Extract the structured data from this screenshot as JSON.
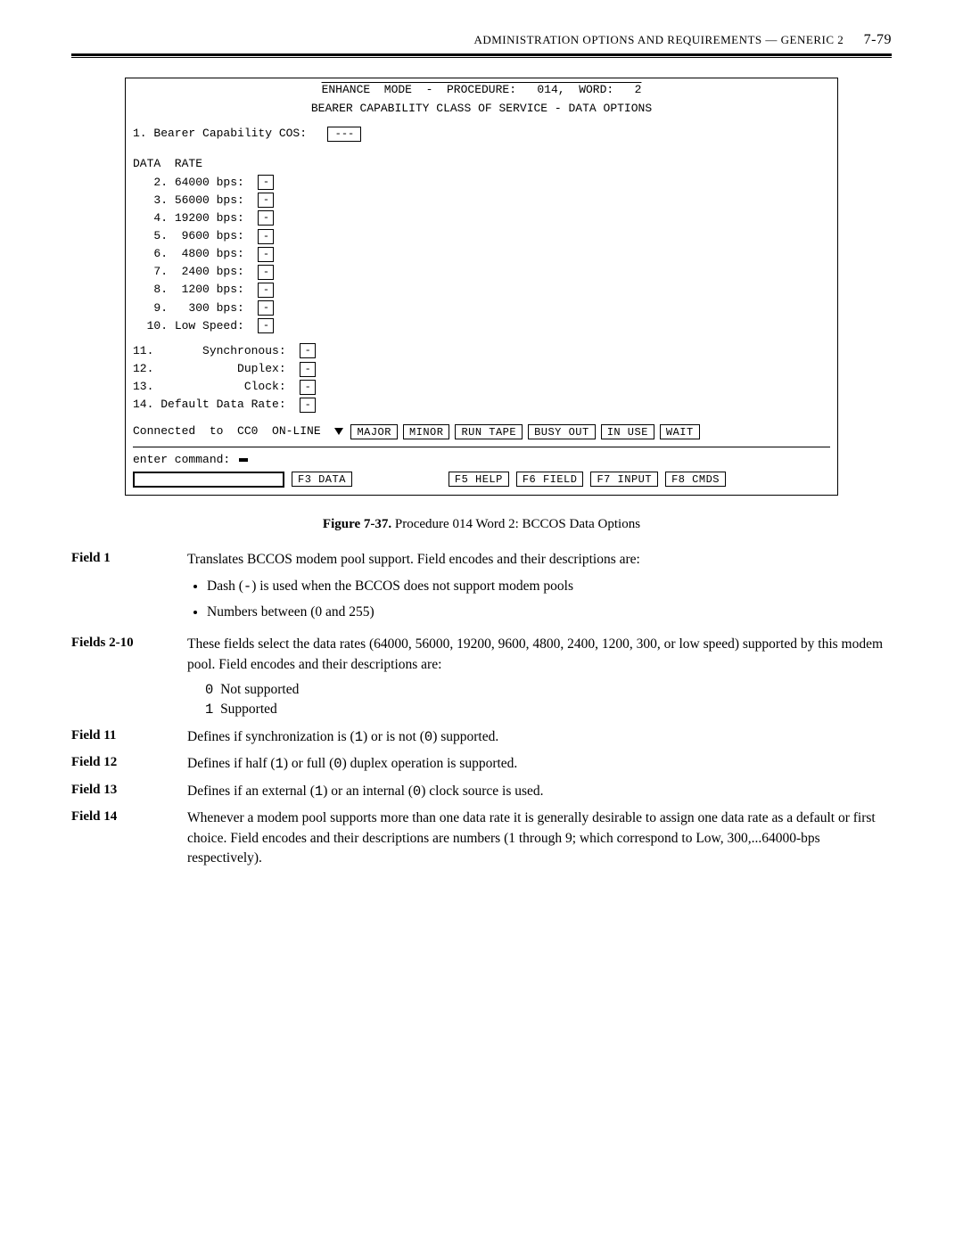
{
  "header": {
    "running_title": "ADMINISTRATION  OPTIONS  AND  REQUIREMENTS  —  GENERIC  2",
    "page_number": "7-79"
  },
  "terminal": {
    "mode_line": "ENHANCE  MODE  -  PROCEDURE:   014,  WORD:   2",
    "subtitle": "BEARER  CAPABILITY  CLASS  OF  SERVICE  -  DATA  OPTIONS",
    "field1_label": "1. Bearer Capability COS:",
    "field1_value": "---",
    "data_rate_heading": "DATA  RATE",
    "rates": [
      {
        "idx": " 2.",
        "label": "64000 bps:",
        "val": "-"
      },
      {
        "idx": " 3.",
        "label": "56000 bps:",
        "val": "-"
      },
      {
        "idx": " 4.",
        "label": "19200 bps:",
        "val": "-"
      },
      {
        "idx": " 5.",
        "label": " 9600 bps:",
        "val": "-"
      },
      {
        "idx": " 6.",
        "label": " 4800 bps:",
        "val": "-"
      },
      {
        "idx": " 7.",
        "label": " 2400 bps:",
        "val": "-"
      },
      {
        "idx": " 8.",
        "label": " 1200 bps:",
        "val": "-"
      },
      {
        "idx": " 9.",
        "label": "  300 bps:",
        "val": "-"
      },
      {
        "idx": "10.",
        "label": "Low Speed:",
        "val": "-"
      }
    ],
    "extras": [
      {
        "idx": "11.",
        "label": "      Synchronous:",
        "val": "-"
      },
      {
        "idx": "12.",
        "label": "           Duplex:",
        "val": "-"
      },
      {
        "idx": "13.",
        "label": "            Clock:",
        "val": "-"
      },
      {
        "idx": "14.",
        "label": "Default Data Rate:",
        "val": "-"
      }
    ],
    "status_prefix": "Connected  to  CC0  ON-LINE ",
    "status_buttons": [
      "MAJOR",
      "MINOR",
      "RUN TAPE",
      "BUSY OUT",
      "IN USE",
      "WAIT"
    ],
    "cmd_label": "enter  command:",
    "fkeys_row1": [
      "F3 DATA"
    ],
    "fkeys_row2": [
      "F5 HELP",
      "F6 FIELD",
      "F7 INPUT",
      "F8 CMDS"
    ]
  },
  "figure": {
    "label": "Figure 7-37.",
    "caption": "Procedure 014 Word 2: BCCOS Data Options"
  },
  "definitions": {
    "field1": {
      "label": "Field 1",
      "text": "Translates BCCOS modem pool support. Field encodes and their descriptions are:",
      "bullet1a": "Dash (",
      "bullet1_dash": "-",
      "bullet1b": ")  is used when the BCCOS does not support modem pools",
      "bullet2": "Numbers between (0 and 255)"
    },
    "fields2_10": {
      "label": "Fields 2-10",
      "text": "These fields select the data rates (64000, 56000, 19200, 9600, 4800, 2400, 1200, 300, or low speed) supported by this modem pool. Field encodes and their descriptions are:",
      "code0": "0",
      "opt0": "Not supported",
      "code1": "1",
      "opt1": "Supported"
    },
    "field11": {
      "label": "Field 11",
      "pre": "Defines if synchronization is (",
      "v1": "1",
      "mid": ")  or is not (",
      "v0": "0",
      "post": ")  supported."
    },
    "field12": {
      "label": "Field 12",
      "pre": "Defines if half (",
      "v1": "1",
      "mid": ")  or full (",
      "v0": "0",
      "post": ")  duplex operation is supported."
    },
    "field13": {
      "label": "Field 13",
      "pre": "Defines if an external (",
      "v1": "1",
      "mid": ")  or an internal (",
      "v0": "0",
      "post": ")  clock source is used."
    },
    "field14": {
      "label": "Field 14",
      "text": "Whenever a modem pool supports more than one data rate it is generally desirable to assign one data rate as a default or first choice. Field encodes and their descriptions are numbers (1 through 9; which correspond to Low, 300,...64000-bps respectively)."
    }
  }
}
